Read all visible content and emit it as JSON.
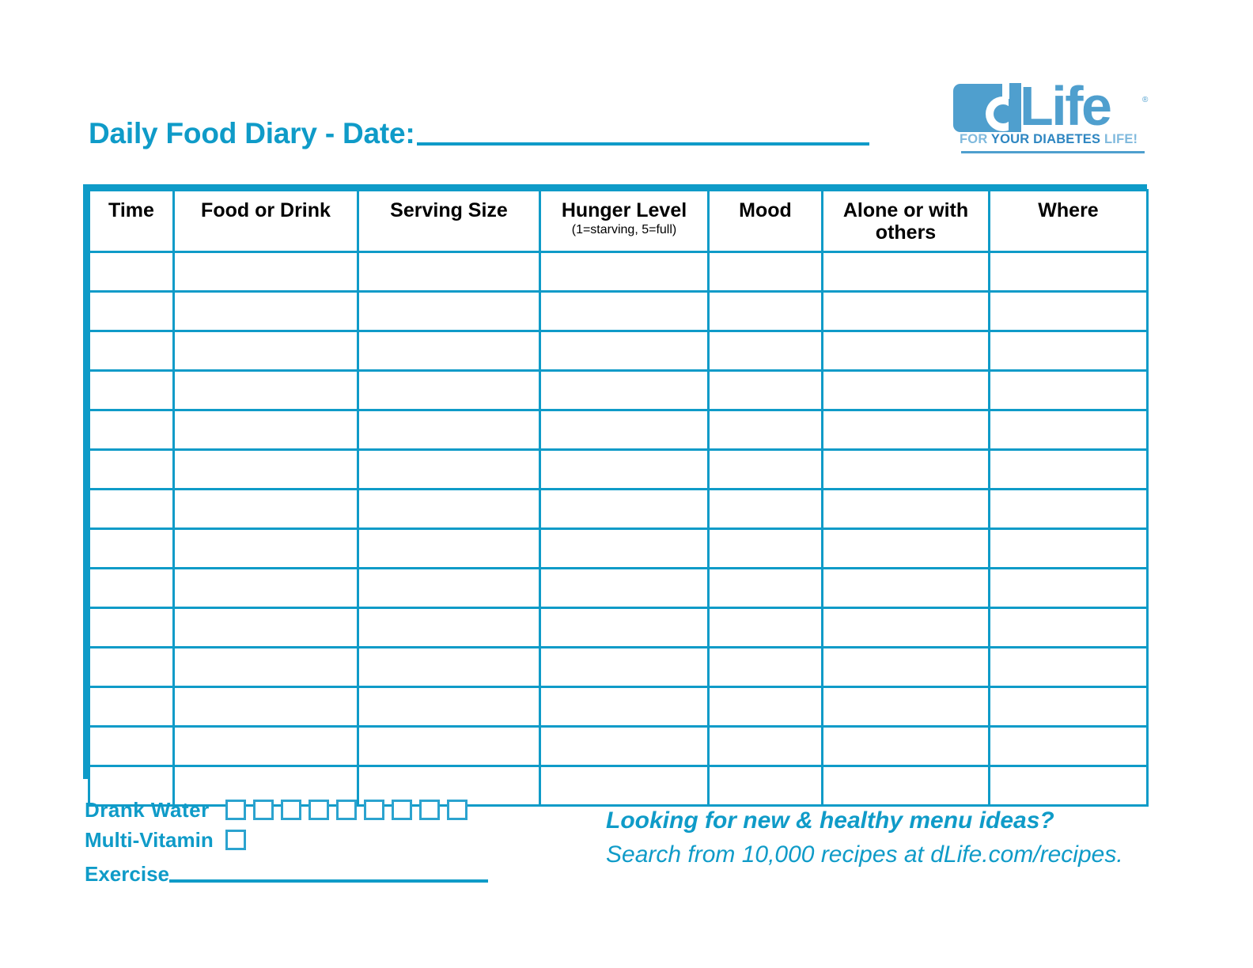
{
  "document": {
    "title": "Daily Food Diary - Date:",
    "accent_color": "#0f9bc8",
    "logo_color": "#4f9fce"
  },
  "logo": {
    "mark_letter": "d",
    "wordmark": "Life",
    "registered_mark": "®",
    "tagline_prefix": "FOR ",
    "tagline_strong": "YOUR DIABETES",
    "tagline_suffix": " LIFE!"
  },
  "table": {
    "columns": [
      {
        "label": "Time",
        "sub": ""
      },
      {
        "label": "Food or Drink",
        "sub": ""
      },
      {
        "label": "Serving Size",
        "sub": ""
      },
      {
        "label": "Hunger Level",
        "sub": "(1=starving, 5=full)"
      },
      {
        "label": "Mood",
        "sub": ""
      },
      {
        "label": "Alone or with others",
        "sub": ""
      },
      {
        "label": "Where",
        "sub": ""
      }
    ],
    "row_count": 14,
    "rows": [
      [
        "",
        "",
        "",
        "",
        "",
        "",
        ""
      ],
      [
        "",
        "",
        "",
        "",
        "",
        "",
        ""
      ],
      [
        "",
        "",
        "",
        "",
        "",
        "",
        ""
      ],
      [
        "",
        "",
        "",
        "",
        "",
        "",
        ""
      ],
      [
        "",
        "",
        "",
        "",
        "",
        "",
        ""
      ],
      [
        "",
        "",
        "",
        "",
        "",
        "",
        ""
      ],
      [
        "",
        "",
        "",
        "",
        "",
        "",
        ""
      ],
      [
        "",
        "",
        "",
        "",
        "",
        "",
        ""
      ],
      [
        "",
        "",
        "",
        "",
        "",
        "",
        ""
      ],
      [
        "",
        "",
        "",
        "",
        "",
        "",
        ""
      ],
      [
        "",
        "",
        "",
        "",
        "",
        "",
        ""
      ],
      [
        "",
        "",
        "",
        "",
        "",
        "",
        ""
      ],
      [
        "",
        "",
        "",
        "",
        "",
        "",
        ""
      ],
      [
        "",
        "",
        "",
        "",
        "",
        "",
        ""
      ]
    ]
  },
  "tracker": {
    "water_label": "Drank  Water",
    "water_checkbox_count": 9,
    "vitamin_label": "Multi-Vitamin",
    "vitamin_checkbox_count": 1,
    "exercise_label": "Exercise"
  },
  "promo": {
    "headline": "Looking for new & healthy menu ideas?",
    "subline": "Search from 10,000 recipes at dLife.com/recipes."
  }
}
